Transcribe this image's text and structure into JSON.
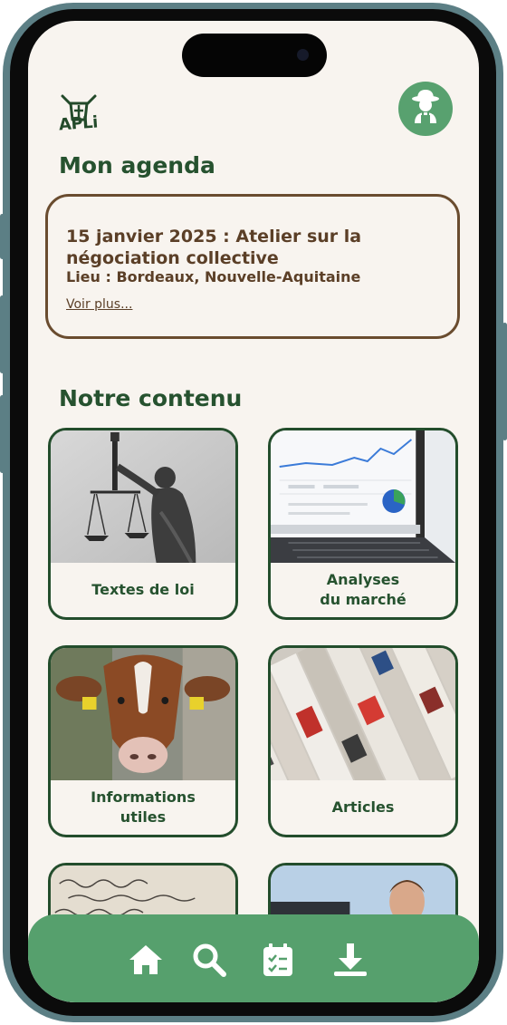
{
  "app": {
    "logo_text": "APLi",
    "brand_green": "#56a06d",
    "brand_dark_green": "#26522f",
    "accent_brown": "#5b3f27"
  },
  "header": {
    "profile_icon": "farmer-avatar-icon"
  },
  "agenda": {
    "title": "Mon agenda",
    "event": {
      "title": "15 janvier 2025 : Atelier sur la négociation collective",
      "location": "Lieu : Bordeaux, Nouvelle-Aquitaine",
      "more_link": "Voir plus..."
    }
  },
  "content": {
    "title": "Notre contenu",
    "tiles": [
      {
        "label": "Textes de loi",
        "image": "lady-justice-statue"
      },
      {
        "label": "Analyses\ndu marché",
        "image": "laptop-market-charts"
      },
      {
        "label": "Informations\nutiles",
        "image": "cow-portrait"
      },
      {
        "label": "Articles",
        "image": "stacked-newspapers"
      },
      {
        "label": "",
        "image": "handwritten-letter"
      },
      {
        "label": "",
        "image": "man-portrait"
      }
    ]
  },
  "bottom_nav": {
    "items": [
      {
        "icon": "home-icon"
      },
      {
        "icon": "search-icon"
      },
      {
        "icon": "calendar-checklist-icon"
      },
      {
        "icon": "download-icon"
      }
    ]
  }
}
